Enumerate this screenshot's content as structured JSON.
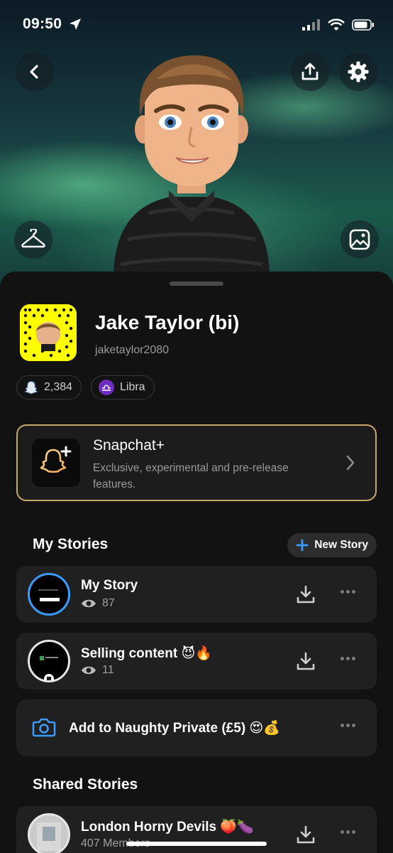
{
  "status_bar": {
    "time": "09:50"
  },
  "profile": {
    "display_name": "Jake Taylor (bi)",
    "username": "jaketaylor2080",
    "snap_score": "2,384",
    "zodiac": "Libra"
  },
  "snapchat_plus": {
    "title": "Snapchat+",
    "subtitle": "Exclusive, experimental and pre-release features."
  },
  "my_stories": {
    "title": "My Stories",
    "new_story_label": "New Story",
    "items": [
      {
        "title": "My Story",
        "views": "87",
        "thumb_text": "Selling content"
      },
      {
        "title": "Selling content 😈🔥",
        "views": "11"
      }
    ],
    "add_private": "Add to Naughty Private (£5) 😍💰"
  },
  "shared_stories": {
    "title": "Shared Stories",
    "items": [
      {
        "title": "London Horny Devils 🍑🍆",
        "members": "407 Members"
      }
    ]
  },
  "colors": {
    "accent_blue": "#3b9cff",
    "gold": "#c8a868",
    "snap_yellow": "#fffc00",
    "zodiac_purple": "#6f2dbd"
  }
}
